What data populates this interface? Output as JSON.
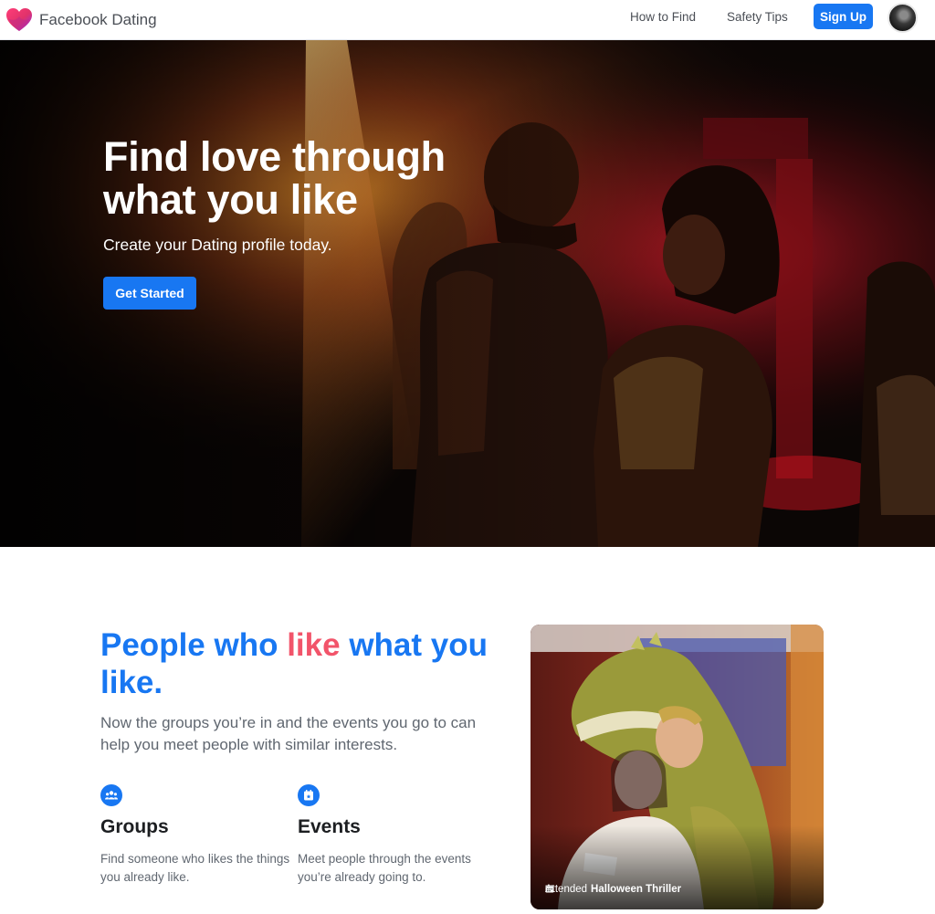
{
  "nav": {
    "brand": "Facebook Dating",
    "links": [
      "How to Find",
      "Safety Tips"
    ],
    "signup_label": "Sign Up"
  },
  "hero": {
    "title": "Find love through what you like",
    "subtitle": "Create your Dating profile today.",
    "cta_label": "Get Started"
  },
  "feature": {
    "title_part1": "People who ",
    "title_highlight": "like",
    "title_part2": " what you like.",
    "description": "Now the groups you’re in and the events you go to can help you meet people with similar interests.",
    "columns": [
      {
        "icon": "groups-icon",
        "title": "Groups",
        "description": "Find someone who likes the things you already like."
      },
      {
        "icon": "events-icon",
        "title": "Events",
        "description": "Meet people through the events you’re already going to."
      }
    ]
  },
  "photo_card": {
    "caption_prefix": "Attended",
    "caption_event": "Halloween Thriller"
  },
  "colors": {
    "brand_blue": "#1877f2",
    "highlight_pink": "#f2546a",
    "heading_dark": "#1c1e21",
    "body_gray": "#606770"
  }
}
